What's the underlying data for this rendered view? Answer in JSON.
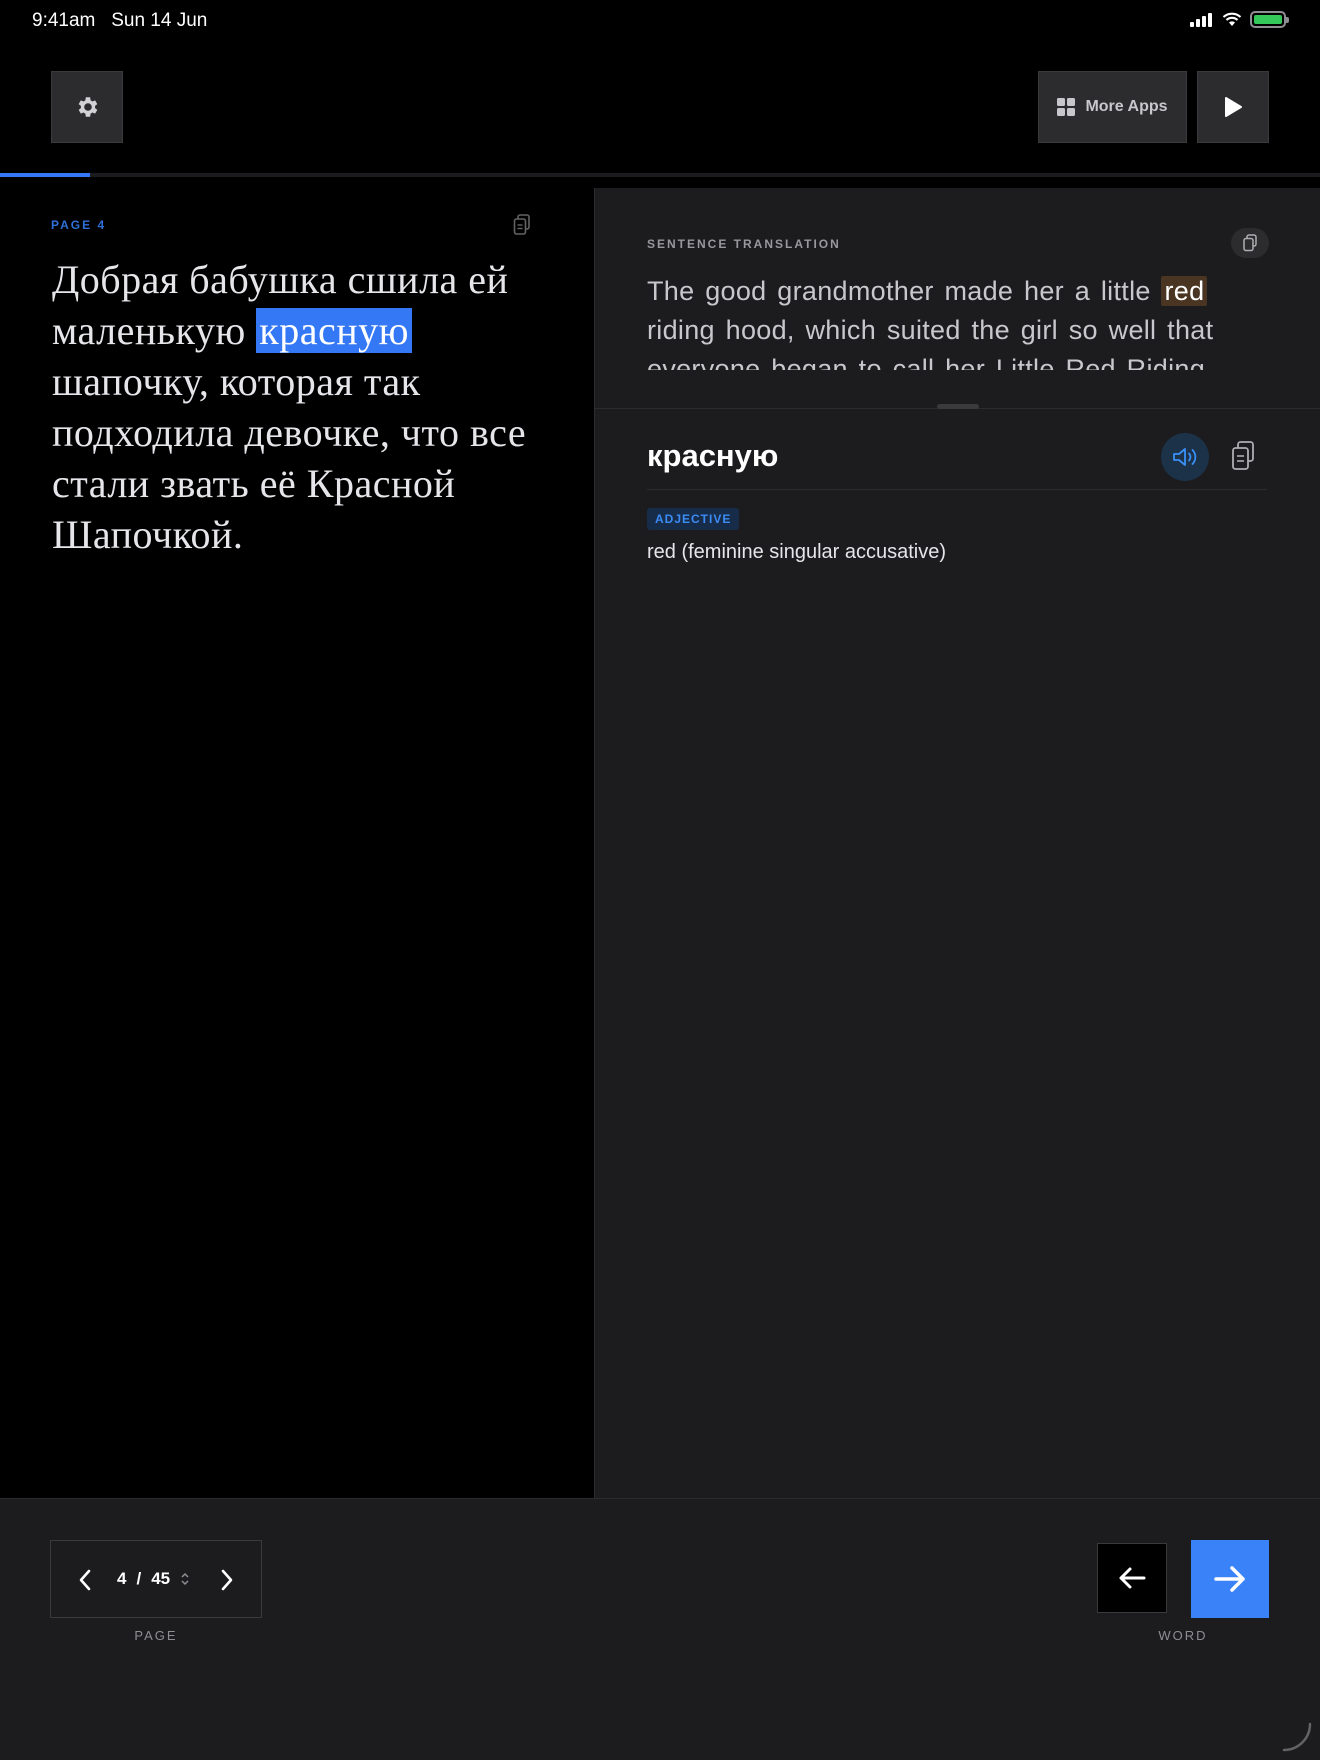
{
  "status_bar": {
    "time": "9:41am",
    "date": "Sun 14 Jun"
  },
  "toolbar": {
    "more_apps_label": "More Apps",
    "settings_icon": "gear-icon",
    "play_icon": "play-icon"
  },
  "progress": {
    "fraction": 0.068
  },
  "reader": {
    "page_label": "PAGE 4",
    "text_before": "Добрая бабушка сшила ей маленькую ",
    "highlighted_word": "красную",
    "text_after": " шапочку, которая так подходила девочке, что все стали звать её Красной Шапочкой."
  },
  "translation": {
    "label": "SENTENCE TRANSLATION",
    "text_before": "The good grandmother made her a little ",
    "highlighted_word": "red",
    "text_after": " riding hood, which suited the girl so well that everyone began to call her Little Red Riding"
  },
  "word_detail": {
    "word": "красную",
    "part_of_speech": "ADJECTIVE",
    "definition": "red (feminine singular accusative)"
  },
  "pager": {
    "current": "4",
    "separator": "/",
    "total": "45",
    "caption": "PAGE"
  },
  "word_nav": {
    "caption": "WORD"
  },
  "colors": {
    "accent": "#3478f6",
    "highlight_translation": "#4a3522",
    "panel": "#1c1c1e",
    "background": "#000000"
  }
}
